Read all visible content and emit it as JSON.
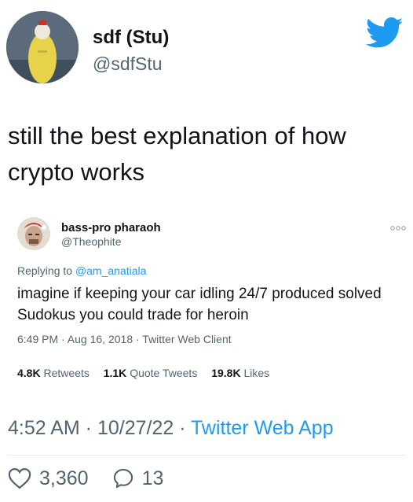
{
  "author": {
    "display_name": "sdf (Stu)",
    "handle": "@sdfStu"
  },
  "tweet": {
    "text": "still the best explanation of how crypto works"
  },
  "quoted": {
    "display_name": "bass-pro pharaoh",
    "handle": "@Theophite",
    "replying_prefix": "Replying to ",
    "replying_to": "@am_anatiala",
    "text": "imagine if keeping your car idling 24/7 produced solved Sudokus you could trade for heroin",
    "meta": "6:49 PM · Aug 16, 2018 · Twitter Web Client",
    "stats": [
      {
        "count": "4.8K",
        "label": "Retweets"
      },
      {
        "count": "1.1K",
        "label": "Quote Tweets"
      },
      {
        "count": "19.8K",
        "label": "Likes"
      }
    ]
  },
  "meta": {
    "time": "4:52 AM · 10/27/22 · ",
    "source": "Twitter Web App"
  },
  "actions": {
    "likes": "3,360",
    "replies": "13"
  },
  "colors": {
    "accent": "#1d9bf0",
    "secondary_text": "#536471",
    "primary_text": "#0f1419"
  },
  "icons": [
    "twitter-bird-icon",
    "more-icon",
    "heart-icon",
    "reply-icon"
  ]
}
